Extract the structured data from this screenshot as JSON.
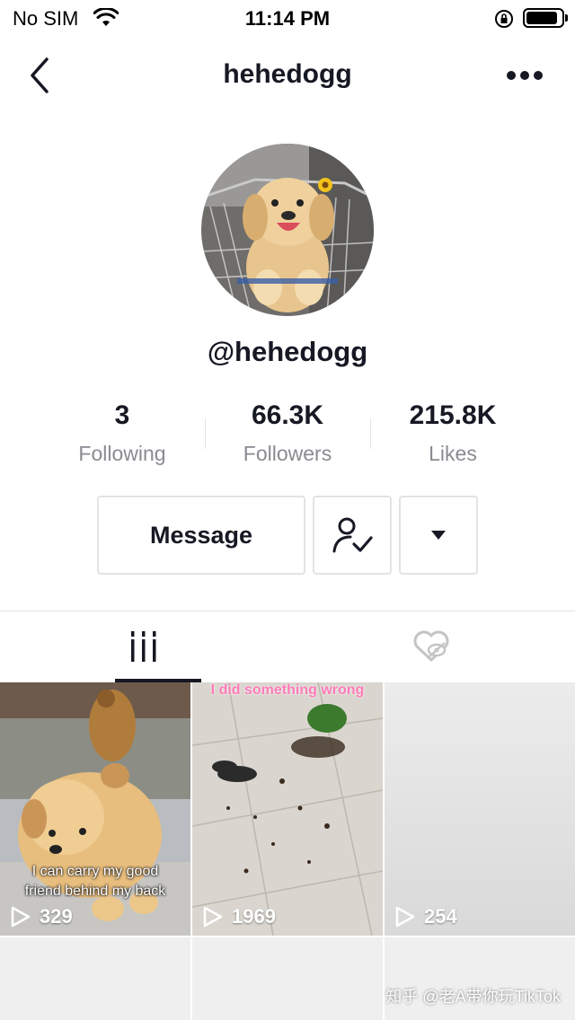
{
  "status_bar": {
    "carrier": "No SIM",
    "time": "11:14 PM"
  },
  "nav": {
    "title": "hehedogg"
  },
  "profile": {
    "handle": "@hehedogg",
    "stats": [
      {
        "value": "3",
        "label": "Following"
      },
      {
        "value": "66.3K",
        "label": "Followers"
      },
      {
        "value": "215.8K",
        "label": "Likes"
      }
    ]
  },
  "actions": {
    "message_label": "Message"
  },
  "tabs": {
    "active": "videos"
  },
  "videos": [
    {
      "views": "329",
      "caption_bottom": [
        "I can carry my good",
        "friend behind my back"
      ]
    },
    {
      "views": "1969",
      "caption_top": "I did something wrong"
    },
    {
      "views": "254"
    }
  ],
  "watermark": "知乎 @老A带你玩TikTok",
  "colors": {
    "text": "#161823",
    "secondary": "#8a8b91",
    "border": "#e3e3e4"
  }
}
